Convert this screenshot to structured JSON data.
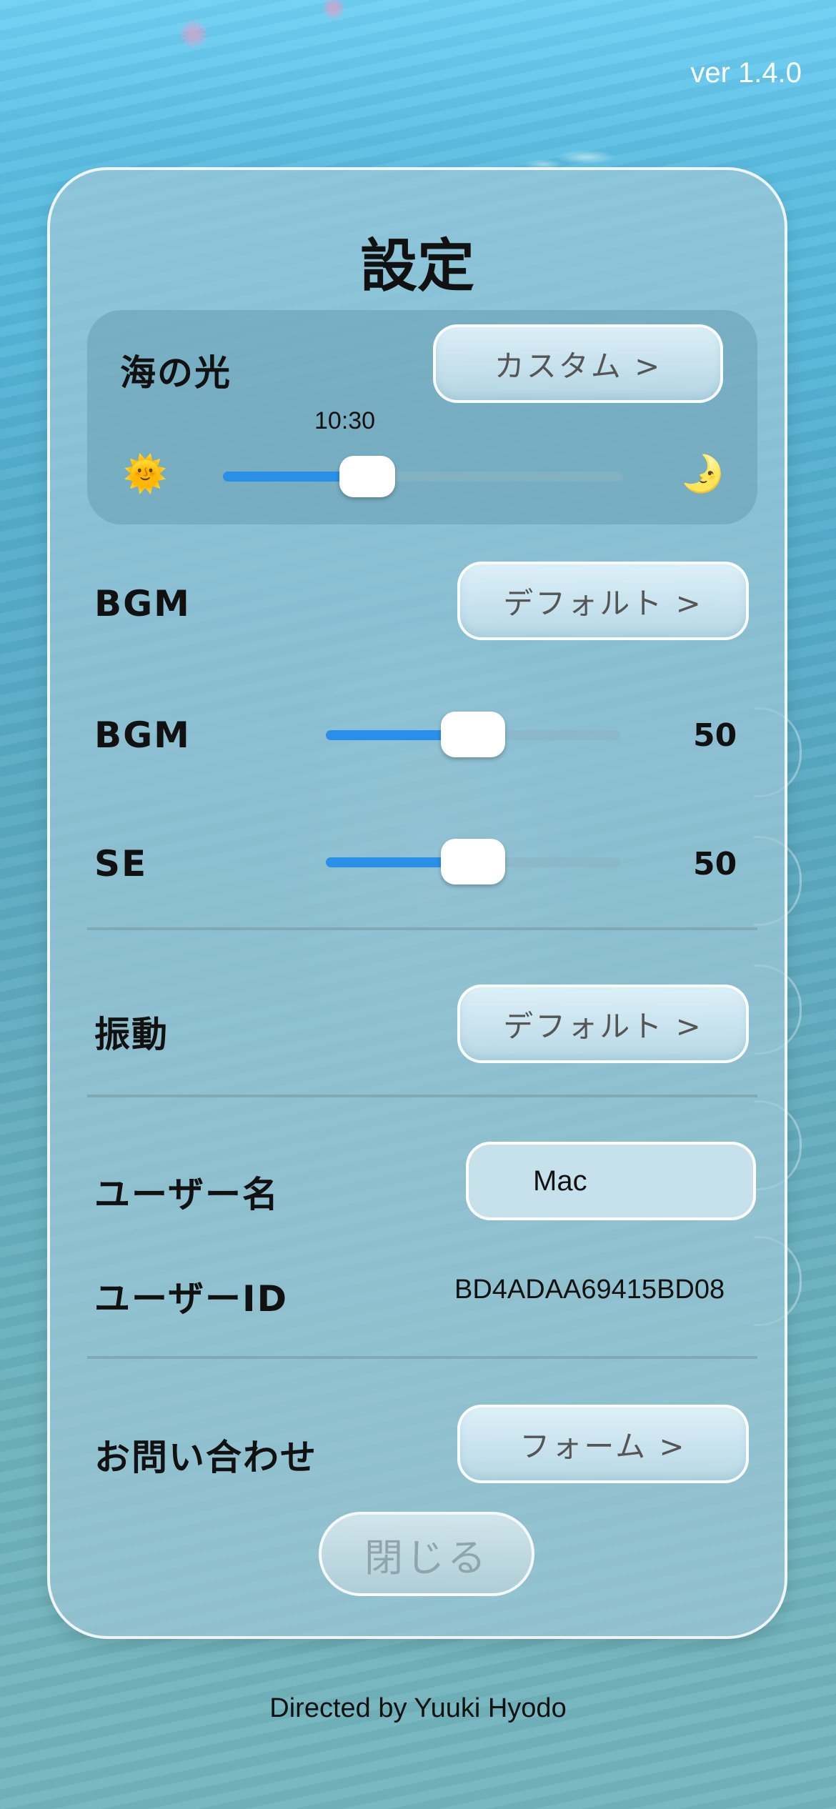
{
  "app": {
    "version": "ver 1.4.0",
    "footer": "Directed by Yuuki Hyodo"
  },
  "settings": {
    "title": "設定",
    "sea_light": {
      "label": "海の光",
      "button": "カスタム >",
      "time": "10:30",
      "value": 0.36,
      "start_icon": "sun-icon",
      "end_icon": "moon-icon"
    },
    "bgm_select": {
      "label": "BGM",
      "button": "デフォルト >"
    },
    "bgm_volume": {
      "label": "BGM",
      "value": 50
    },
    "se_volume": {
      "label": "SE",
      "value": 50
    },
    "vibration": {
      "label": "振動",
      "button": "デフォルト >"
    },
    "username": {
      "label": "ユーザー名",
      "value": "Mac"
    },
    "user_id": {
      "label": "ユーザーID",
      "value": "BD4ADAA69415BD08"
    },
    "contact": {
      "label": "お問い合わせ",
      "button": "フォーム >"
    },
    "close": "閉じる"
  },
  "colors": {
    "accent": "#2a8fe8",
    "panel": "#9ec8d7",
    "text": "#111111"
  }
}
